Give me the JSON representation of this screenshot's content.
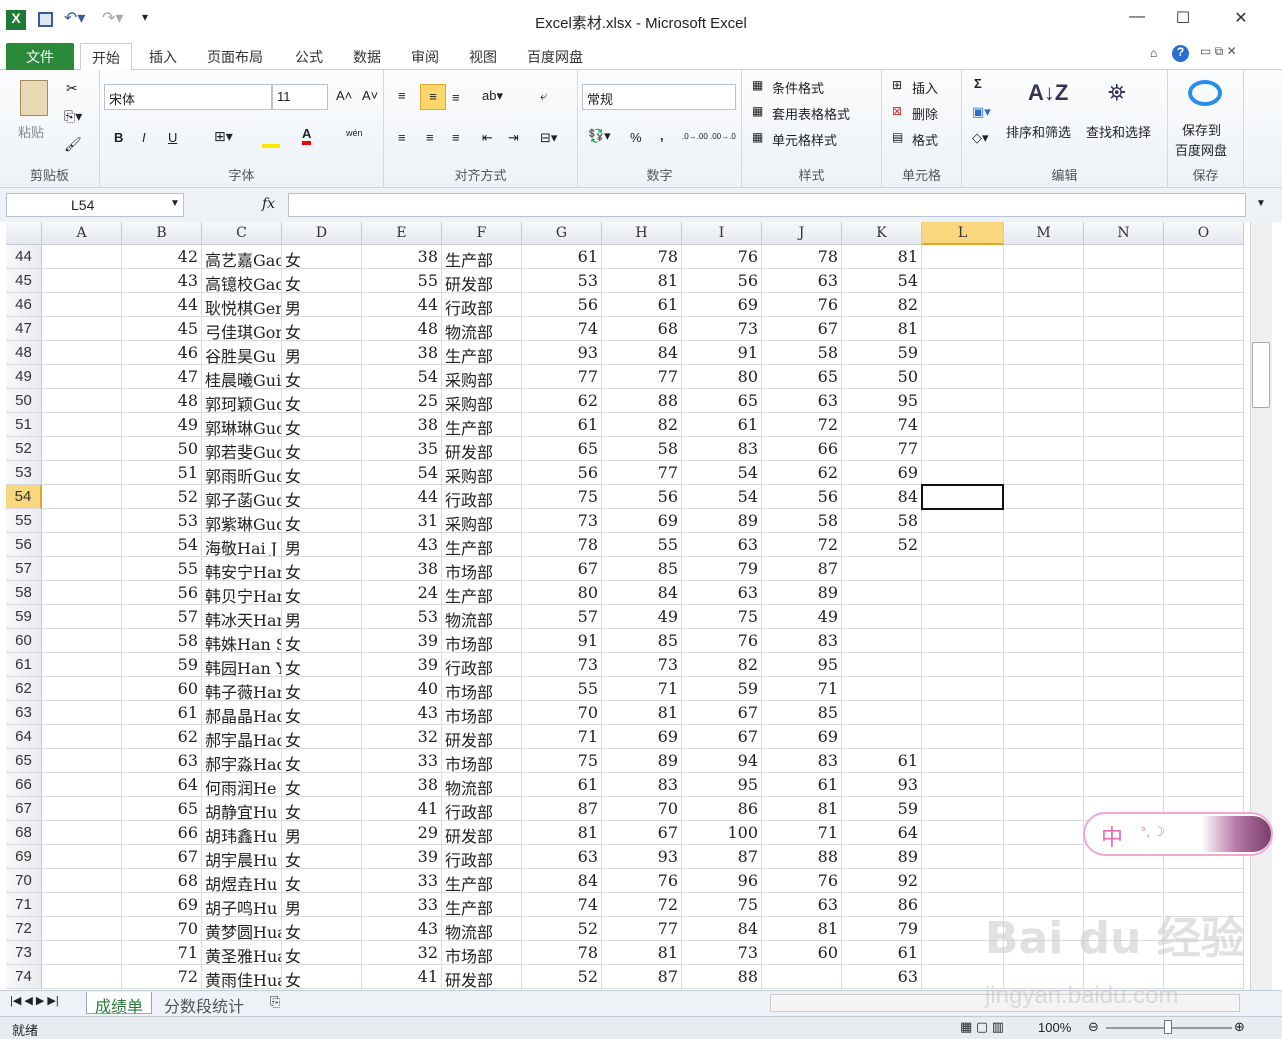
{
  "window": {
    "title": "Excel素材.xlsx - Microsoft Excel",
    "minimize": "—",
    "maximize": "☐",
    "close": "✕"
  },
  "tabs": [
    "文件",
    "开始",
    "插入",
    "页面布局",
    "公式",
    "数据",
    "审阅",
    "视图",
    "百度网盘"
  ],
  "ribbon": {
    "clipboard": {
      "label": "剪贴板",
      "paste": "粘贴"
    },
    "font": {
      "label": "字体",
      "name": "宋体",
      "size": "11",
      "bold": "B",
      "italic": "I",
      "underline": "U",
      "grow": "A˄",
      "shrink": "A˅",
      "color": "A",
      "wen": "wén"
    },
    "alignment": {
      "label": "对齐方式"
    },
    "number": {
      "label": "数字",
      "format": "常规",
      "percent": "%",
      "comma": ",",
      "inc": ".0→.00",
      "dec": ".00→.0"
    },
    "styles": {
      "label": "样式",
      "conditional": "条件格式",
      "table": "套用表格格式",
      "cell": "单元格样式"
    },
    "cells": {
      "label": "单元格",
      "insert": "插入",
      "delete": "删除",
      "format": "格式"
    },
    "editing": {
      "label": "编辑",
      "sum": "Σ",
      "sort": "排序和筛选",
      "find": "查找和选择"
    },
    "save": {
      "label": "保存",
      "button": "保存到\n百度网盘",
      "line1": "保存到",
      "line2": "百度网盘"
    }
  },
  "formula_bar": {
    "name_box": "L54",
    "fx": "fx",
    "value": ""
  },
  "columns": [
    "A",
    "B",
    "C",
    "D",
    "E",
    "F",
    "G",
    "H",
    "I",
    "J",
    "K",
    "L",
    "M",
    "N",
    "O"
  ],
  "selected_cell": "L54",
  "rows": [
    [
      44,
      "42",
      "高艺嘉Gao",
      "女",
      "38",
      "生产部",
      "61",
      "78",
      "76",
      "78",
      "81"
    ],
    [
      45,
      "43",
      "高镱校Gao",
      "女",
      "55",
      "研发部",
      "53",
      "81",
      "56",
      "63",
      "54"
    ],
    [
      46,
      "44",
      "耿悦棋Gen",
      "男",
      "44",
      "行政部",
      "56",
      "61",
      "69",
      "76",
      "82"
    ],
    [
      47,
      "45",
      "弓佳琪Gon",
      "女",
      "48",
      "物流部",
      "74",
      "68",
      "73",
      "67",
      "81"
    ],
    [
      48,
      "46",
      "谷胜昊Gu",
      "男",
      "38",
      "生产部",
      "93",
      "84",
      "91",
      "58",
      "59"
    ],
    [
      49,
      "47",
      "桂晨曦Gui",
      "女",
      "54",
      "采购部",
      "77",
      "77",
      "80",
      "65",
      "50"
    ],
    [
      50,
      "48",
      "郭珂颖Guo",
      "女",
      "25",
      "采购部",
      "62",
      "88",
      "65",
      "63",
      "95"
    ],
    [
      51,
      "49",
      "郭琳琳Guo",
      "女",
      "38",
      "生产部",
      "61",
      "82",
      "61",
      "72",
      "74"
    ],
    [
      52,
      "50",
      "郭若斐Guo",
      "女",
      "35",
      "研发部",
      "65",
      "58",
      "83",
      "66",
      "77"
    ],
    [
      53,
      "51",
      "郭雨昕Guo",
      "女",
      "54",
      "采购部",
      "56",
      "77",
      "54",
      "62",
      "69"
    ],
    [
      54,
      "52",
      "郭子菡Guo",
      "女",
      "44",
      "行政部",
      "75",
      "56",
      "54",
      "56",
      "84"
    ],
    [
      55,
      "53",
      "郭紫琳Guo",
      "女",
      "31",
      "采购部",
      "73",
      "69",
      "89",
      "58",
      "58"
    ],
    [
      56,
      "54",
      "海敬Hai J",
      "男",
      "43",
      "生产部",
      "78",
      "55",
      "63",
      "72",
      "52"
    ],
    [
      57,
      "55",
      "韩安宁Han",
      "女",
      "38",
      "市场部",
      "67",
      "85",
      "79",
      "87",
      ""
    ],
    [
      58,
      "56",
      "韩贝宁Han",
      "女",
      "24",
      "生产部",
      "80",
      "84",
      "63",
      "89",
      ""
    ],
    [
      59,
      "57",
      "韩冰天Han",
      "男",
      "53",
      "物流部",
      "57",
      "49",
      "75",
      "49",
      ""
    ],
    [
      60,
      "58",
      "韩姝Han S",
      "女",
      "39",
      "市场部",
      "91",
      "85",
      "76",
      "83",
      ""
    ],
    [
      61,
      "59",
      "韩园Han Y",
      "女",
      "39",
      "行政部",
      "73",
      "73",
      "82",
      "95",
      ""
    ],
    [
      62,
      "60",
      "韩子薇Han",
      "女",
      "40",
      "市场部",
      "55",
      "71",
      "59",
      "71",
      ""
    ],
    [
      63,
      "61",
      "郝晶晶Hao",
      "女",
      "43",
      "市场部",
      "70",
      "81",
      "67",
      "85",
      ""
    ],
    [
      64,
      "62",
      "郝宇晶Hao",
      "女",
      "32",
      "研发部",
      "71",
      "69",
      "67",
      "69",
      ""
    ],
    [
      65,
      "63",
      "郝宇淼Hao",
      "女",
      "33",
      "市场部",
      "75",
      "89",
      "94",
      "83",
      "61"
    ],
    [
      66,
      "64",
      "何雨润He",
      "女",
      "38",
      "物流部",
      "61",
      "83",
      "95",
      "61",
      "93"
    ],
    [
      67,
      "65",
      "胡静宜Hu",
      "女",
      "41",
      "行政部",
      "87",
      "70",
      "86",
      "81",
      "59"
    ],
    [
      68,
      "66",
      "胡玮鑫Hu",
      "男",
      "29",
      "研发部",
      "81",
      "67",
      "100",
      "71",
      "64"
    ],
    [
      69,
      "67",
      "胡宇晨Hu",
      "女",
      "39",
      "行政部",
      "63",
      "93",
      "87",
      "88",
      "89"
    ],
    [
      70,
      "68",
      "胡煜垚Hu",
      "女",
      "33",
      "生产部",
      "84",
      "76",
      "96",
      "76",
      "92"
    ],
    [
      71,
      "69",
      "胡子鸣Hu",
      "男",
      "33",
      "生产部",
      "74",
      "72",
      "75",
      "63",
      "86"
    ],
    [
      72,
      "70",
      "黄梦圆Hua",
      "女",
      "43",
      "物流部",
      "52",
      "77",
      "84",
      "81",
      "79"
    ],
    [
      73,
      "71",
      "黄圣雅Hua",
      "女",
      "32",
      "市场部",
      "78",
      "81",
      "73",
      "60",
      "61"
    ],
    [
      74,
      "72",
      "黄雨佳Hua",
      "女",
      "41",
      "研发部",
      "52",
      "87",
      "88",
      "",
      "63"
    ]
  ],
  "sheets": [
    "成绩单",
    "分数段统计"
  ],
  "status": {
    "ready": "就绪",
    "zoom": "100%"
  },
  "ime": {
    "label": "中"
  },
  "watermark": {
    "brand": "Bai du 经验",
    "url": "jingyan.baidu.com"
  }
}
